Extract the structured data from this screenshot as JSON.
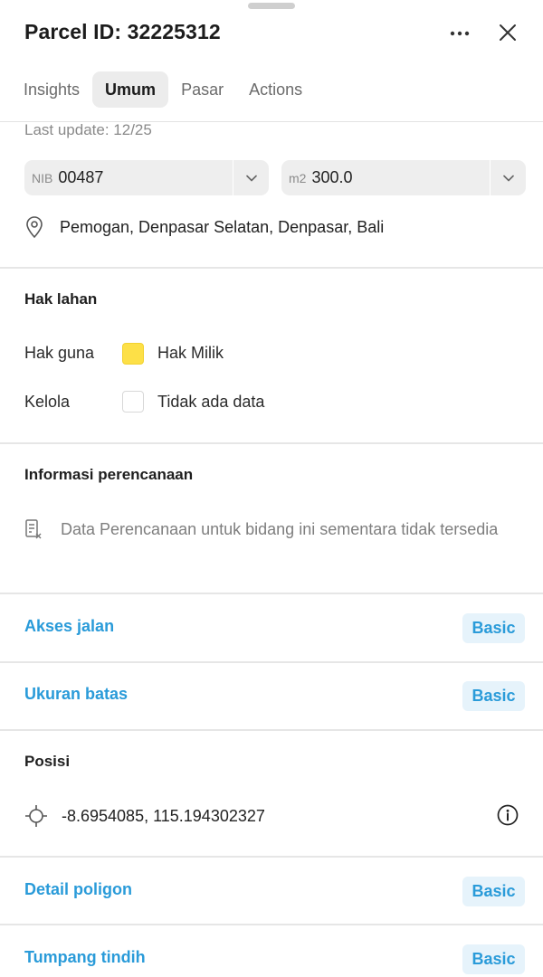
{
  "header": {
    "title": "Parcel ID: 32225312",
    "more_icon": "more-horizontal-icon",
    "close_icon": "close-icon"
  },
  "tabs": [
    {
      "label": "Insights",
      "active": false
    },
    {
      "label": "Umum",
      "active": true
    },
    {
      "label": "Pasar",
      "active": false
    },
    {
      "label": "Actions",
      "active": false
    }
  ],
  "umum": {
    "last_update": "Last update: 12/25",
    "nib": {
      "prefix": "NIB",
      "value": "00487"
    },
    "area": {
      "prefix": "m2",
      "value": "300.0"
    },
    "address": "Pemogan, Denpasar Selatan, Denpasar, Bali"
  },
  "hak_lahan": {
    "title": "Hak lahan",
    "rows": [
      {
        "label": "Hak guna",
        "value": "Hak Milik",
        "color": "#fde047"
      },
      {
        "label": "Kelola",
        "value": "Tidak ada data",
        "color": "#ffffff"
      }
    ]
  },
  "perencanaan": {
    "title": "Informasi perencanaan",
    "message": "Data Perencanaan untuk bidang ini sementara tidak tersedia"
  },
  "links": [
    {
      "label": "Akses jalan",
      "badge": "Basic"
    },
    {
      "label": "Ukuran batas",
      "badge": "Basic"
    },
    {
      "label": "Detail poligon",
      "badge": "Basic"
    },
    {
      "label": "Tumpang tindih",
      "badge": "Basic"
    }
  ],
  "posisi": {
    "title": "Posisi",
    "coordinates": "-8.6954085, 115.194302327"
  },
  "colors": {
    "accent": "#2a9bd9",
    "badge_bg": "#e6f3fb",
    "active_tab_bg": "#ececec"
  }
}
